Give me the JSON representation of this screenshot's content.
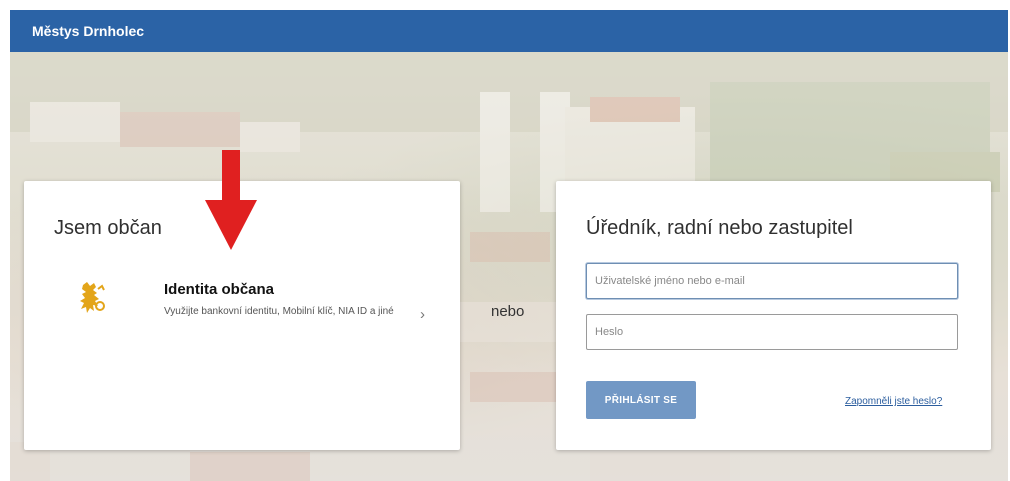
{
  "header": {
    "title": "Městys Drnholec"
  },
  "citizen": {
    "title": "Jsem občan",
    "identity": {
      "title": "Identita občana",
      "description": "Využijte bankovní identitu, Mobilní klíč, NIA ID a jiné",
      "chevron": "›",
      "emblem_icon": "czech-lion-emblem-icon"
    }
  },
  "separator": {
    "text": "nebo"
  },
  "official": {
    "title": "Úředník, radní nebo zastupitel",
    "username": {
      "placeholder": "Uživatelské jméno nebo e-mail",
      "value": ""
    },
    "password": {
      "placeholder": "Heslo",
      "value": ""
    },
    "login_label": "PŘIHLÁSIT SE",
    "forgot_label": "Zapomněli jste heslo?"
  },
  "colors": {
    "header_bg": "#2b63a6",
    "button_bg": "#7298c5",
    "link": "#2b5d9e",
    "annotation_arrow": "#e02020"
  }
}
